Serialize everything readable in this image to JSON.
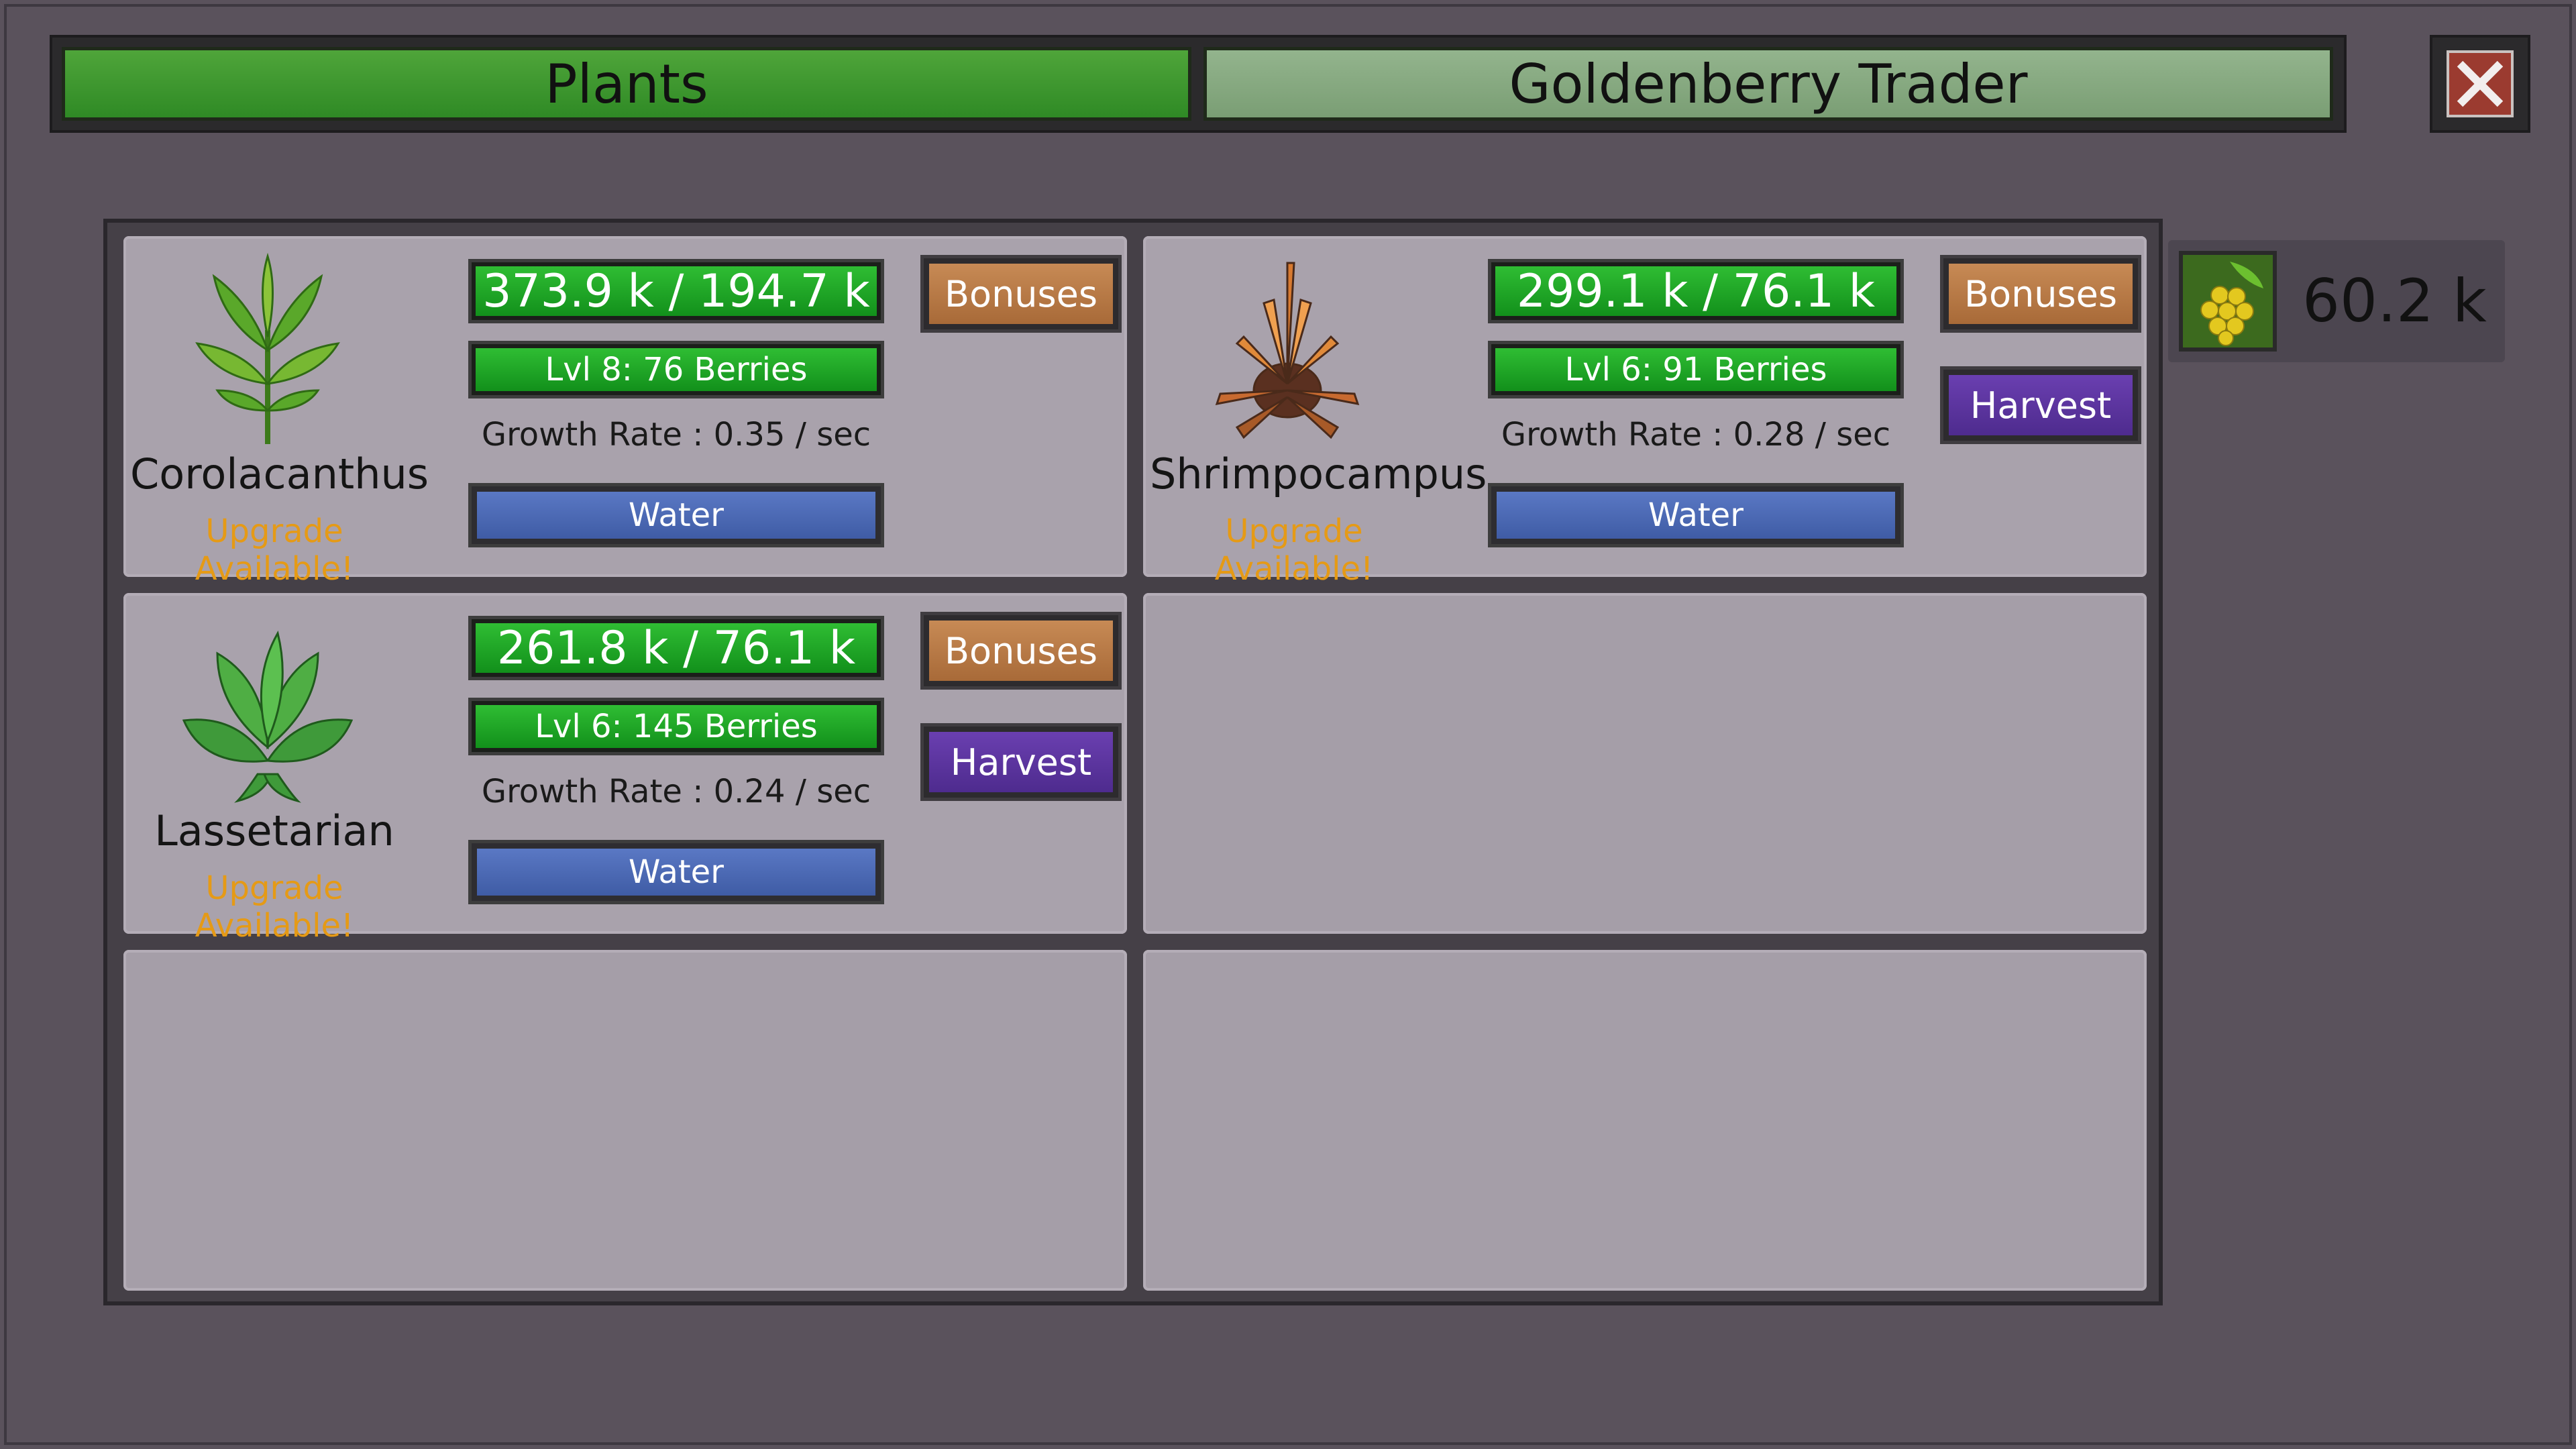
{
  "tabs": {
    "plants": "Plants",
    "trader": "Goldenberry Trader"
  },
  "currency": {
    "icon": "goldenberry-icon",
    "value": "60.2 k"
  },
  "plants": [
    {
      "name": "Corolacanthus",
      "progress": "373.9 k / 194.7 k",
      "level": "Lvl 8: 76 Berries",
      "growth": "Growth Rate : 0.35 / sec",
      "water": "Water",
      "bonuses": "Bonuses",
      "upgrade": "Upgrade Available!"
    },
    {
      "name": "Shrimpocampus",
      "progress": "299.1 k / 76.1 k",
      "level": "Lvl 6: 91 Berries",
      "growth": "Growth Rate : 0.28 / sec",
      "water": "Water",
      "bonuses": "Bonuses",
      "harvest": "Harvest",
      "upgrade": "Upgrade Available!"
    },
    {
      "name": "Lassetarian",
      "progress": "261.8 k / 76.1 k",
      "level": "Lvl 6: 145 Berries",
      "growth": "Growth Rate : 0.24 / sec",
      "water": "Water",
      "bonuses": "Bonuses",
      "harvest": "Harvest",
      "upgrade": "Upgrade Available!"
    }
  ]
}
